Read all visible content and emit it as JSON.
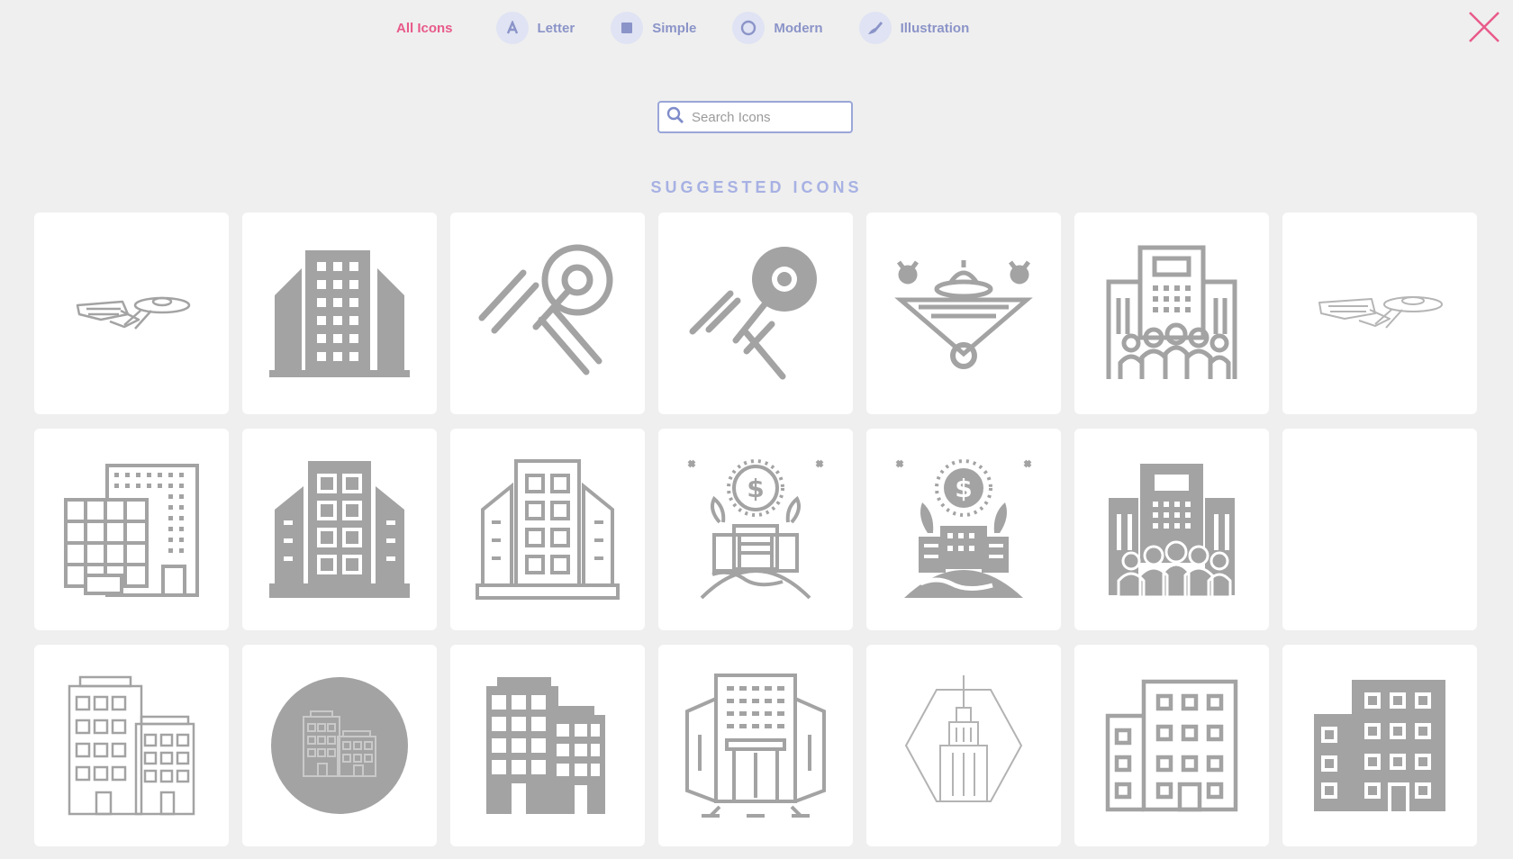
{
  "tabs": [
    {
      "label": "All Icons",
      "active": true,
      "icon": "none"
    },
    {
      "label": "Letter",
      "active": false,
      "icon": "letter-a-icon"
    },
    {
      "label": "Simple",
      "active": false,
      "icon": "square-icon"
    },
    {
      "label": "Modern",
      "active": false,
      "icon": "circle-outline-icon"
    },
    {
      "label": "Illustration",
      "active": false,
      "icon": "brush-icon"
    }
  ],
  "search": {
    "placeholder": "Search Icons",
    "value": ""
  },
  "section_title": "SUGGESTED ICONS",
  "icons": [
    {
      "name": "starship-outline-icon"
    },
    {
      "name": "building-solid-icon"
    },
    {
      "name": "enterprise-outline-icon"
    },
    {
      "name": "enterprise-solid-icon"
    },
    {
      "name": "space-station-icon"
    },
    {
      "name": "office-crowd-outline-icon"
    },
    {
      "name": "starship-outline-light-icon"
    },
    {
      "name": "office-block-outline-icon"
    },
    {
      "name": "building-windows-solid-icon"
    },
    {
      "name": "building-windows-outline-icon"
    },
    {
      "name": "money-globe-outline-icon"
    },
    {
      "name": "money-globe-solid-icon"
    },
    {
      "name": "office-crowd-solid-icon"
    },
    {
      "name": "empty-icon"
    },
    {
      "name": "apartments-outline-icon"
    },
    {
      "name": "building-circle-icon"
    },
    {
      "name": "city-blocks-solid-icon"
    },
    {
      "name": "office-entrance-outline-icon"
    },
    {
      "name": "empire-state-icon"
    },
    {
      "name": "apartment-outline-icon"
    },
    {
      "name": "apartment-solid-icon"
    }
  ],
  "colors": {
    "accent": "#e85a8a",
    "tab_text": "#8b94c8",
    "icon_gray": "#a3a3a3",
    "section_title": "#a7b1e3"
  }
}
